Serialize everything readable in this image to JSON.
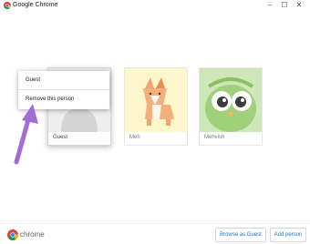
{
  "window": {
    "title": "Google Chrome",
    "controls": {
      "minimize": "–",
      "maximize": "☐",
      "close": "✕"
    }
  },
  "profiles": [
    {
      "name": "Guest"
    },
    {
      "name": "Meh"
    },
    {
      "name": "Mehvish"
    }
  ],
  "context_menu": {
    "items": [
      "Guest",
      "Remove this person"
    ]
  },
  "footer": {
    "wordmark": "chrome",
    "browse_as_guest": "Browse as Guest",
    "add_person": "Add person"
  },
  "colors": {
    "accent": "#1a73e8",
    "arrow": "#a16cd6"
  },
  "icons": {
    "chrome_logo": "chrome-logo-icon",
    "minimize": "minimize-icon",
    "maximize": "maximize-icon",
    "close": "close-icon",
    "arrow": "arrow-annotation-icon"
  }
}
